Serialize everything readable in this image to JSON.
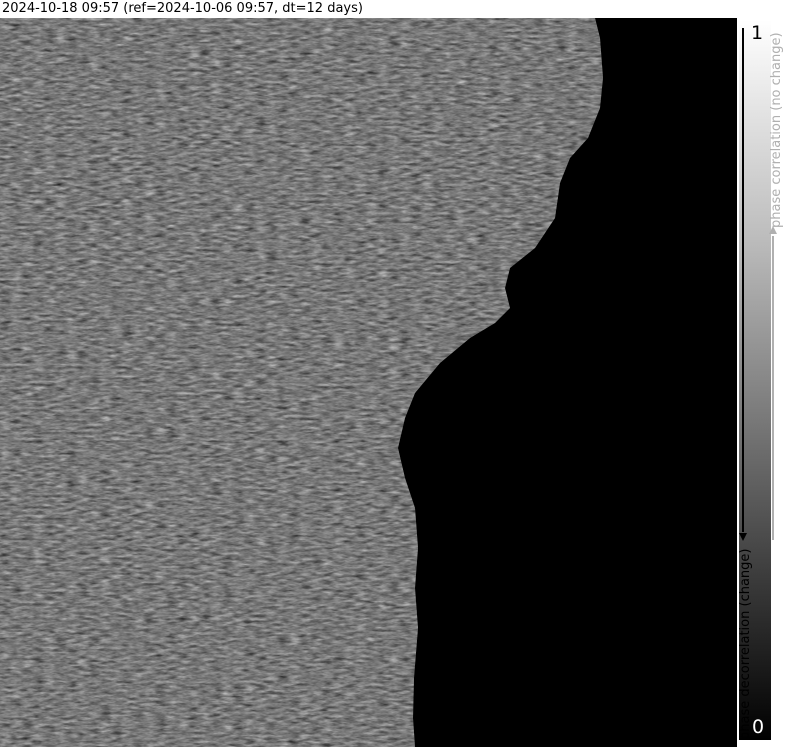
{
  "title": "2024-10-18 09:57 (ref=2024-10-06 09:57, dt=12 days)",
  "colorbar": {
    "max_label": "1",
    "min_label": "0",
    "top_label": "phase correlation (no change)",
    "bottom_label": "phase decorrelation (change)"
  },
  "colors": {
    "background": "#000000",
    "title_text": "#000000",
    "top_label": "#b0b0b0",
    "bottom_label": "#000000"
  }
}
